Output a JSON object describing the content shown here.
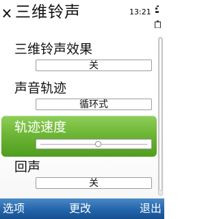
{
  "header": {
    "title": "三维铃声",
    "time": "13:21"
  },
  "settings": [
    {
      "label": "三维铃声效果",
      "value": "关"
    },
    {
      "label": "声音轨迹",
      "value": "循环式"
    },
    {
      "label": "轨迹速度",
      "slider_fraction": 0.54
    },
    {
      "label": "回声",
      "value": "关"
    }
  ],
  "softkeys": {
    "left": "选项",
    "middle": "更改",
    "right": "退出"
  },
  "colors": {
    "highlight": "#6db636",
    "softkey_bar": "#2668ad"
  },
  "icons": [
    "close-icon",
    "battery-icon"
  ]
}
